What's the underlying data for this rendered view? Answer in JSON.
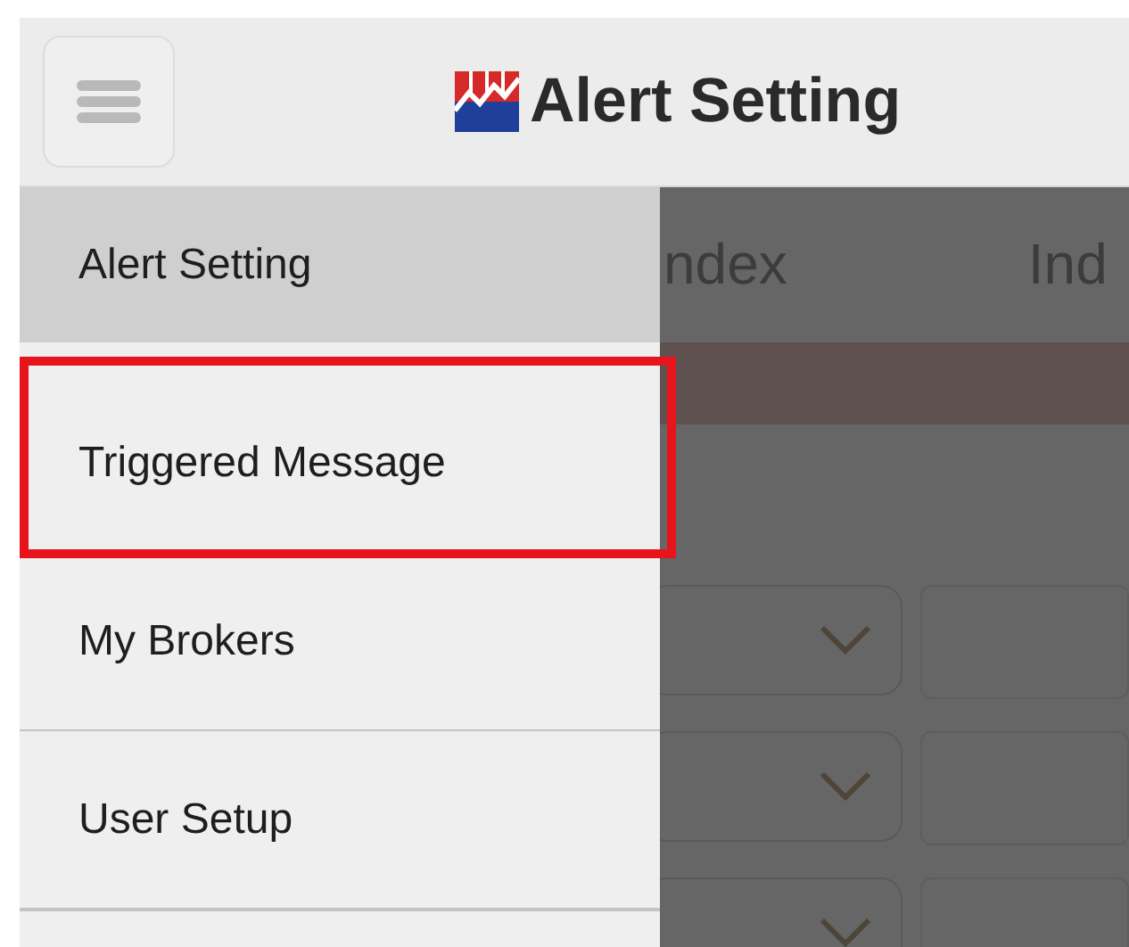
{
  "header": {
    "title": "Alert Setting"
  },
  "background": {
    "tabs": [
      "ndex",
      "Ind"
    ]
  },
  "drawer": {
    "items": [
      {
        "label": "Alert Setting",
        "selected": true,
        "highlighted": false
      },
      {
        "label": "Triggered Message",
        "selected": false,
        "highlighted": true
      },
      {
        "label": "My Brokers",
        "selected": false,
        "highlighted": false
      },
      {
        "label": "User Setup",
        "selected": false,
        "highlighted": false
      }
    ]
  }
}
